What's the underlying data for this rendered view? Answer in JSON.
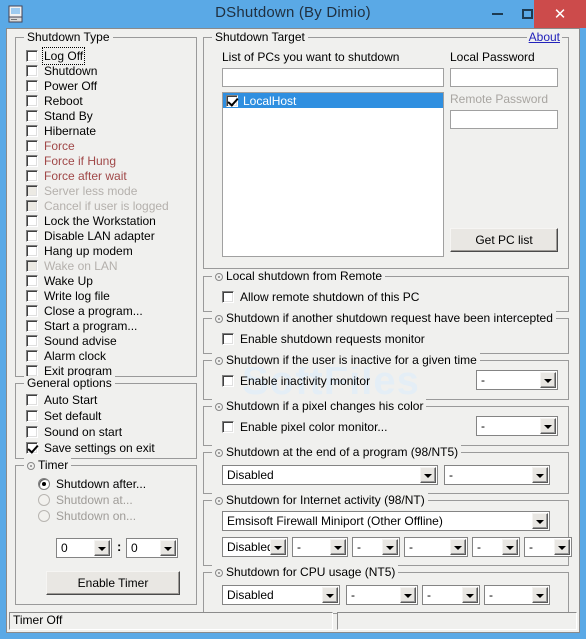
{
  "window": {
    "title": "DShutdown (By Dimio)",
    "app_icon": "computer-icon",
    "minimize_label": "–",
    "maximize_label": "□",
    "close_label": "✕",
    "accent_color": "#5aa9e6",
    "close_color": "#cc4b4b"
  },
  "shutdown_type": {
    "title": "Shutdown Type",
    "items": [
      {
        "label": "Log Off",
        "checked": false,
        "style": "normal",
        "focused": true
      },
      {
        "label": "Shutdown",
        "checked": false,
        "style": "normal",
        "focused": false
      },
      {
        "label": "Power Off",
        "checked": false,
        "style": "normal",
        "focused": false
      },
      {
        "label": "Reboot",
        "checked": false,
        "style": "normal",
        "focused": false
      },
      {
        "label": "Stand By",
        "checked": false,
        "style": "normal",
        "focused": false
      },
      {
        "label": "Hibernate",
        "checked": false,
        "style": "normal",
        "focused": false
      },
      {
        "label": "Force",
        "checked": false,
        "style": "red",
        "focused": false
      },
      {
        "label": "Force if Hung",
        "checked": false,
        "style": "red",
        "focused": false
      },
      {
        "label": "Force after wait",
        "checked": false,
        "style": "red",
        "focused": false
      },
      {
        "label": "Server less mode",
        "checked": false,
        "style": "grey",
        "focused": false
      },
      {
        "label": "Cancel if user is logged",
        "checked": false,
        "style": "grey",
        "focused": false
      },
      {
        "label": "Lock the Workstation",
        "checked": false,
        "style": "normal",
        "focused": false
      },
      {
        "label": "Disable LAN adapter",
        "checked": false,
        "style": "normal",
        "focused": false
      },
      {
        "label": "Hang up modem",
        "checked": false,
        "style": "normal",
        "focused": false
      },
      {
        "label": "Wake on LAN",
        "checked": false,
        "style": "grey",
        "focused": false
      },
      {
        "label": "Wake Up",
        "checked": false,
        "style": "normal",
        "focused": false
      },
      {
        "label": "Write log file",
        "checked": false,
        "style": "normal",
        "focused": false
      },
      {
        "label": "Close a program...",
        "checked": false,
        "style": "normal",
        "focused": false
      },
      {
        "label": "Start a program...",
        "checked": false,
        "style": "normal",
        "focused": false
      },
      {
        "label": "Sound advise",
        "checked": false,
        "style": "normal",
        "focused": false
      },
      {
        "label": "Alarm clock",
        "checked": false,
        "style": "normal",
        "focused": false
      },
      {
        "label": "Exit program",
        "checked": false,
        "style": "normal",
        "focused": false
      }
    ]
  },
  "general_options": {
    "title": "General options",
    "items": [
      {
        "label": "Auto Start",
        "checked": false
      },
      {
        "label": "Set default",
        "checked": false
      },
      {
        "label": "Sound on start",
        "checked": false
      },
      {
        "label": "Save settings on exit",
        "checked": true
      }
    ]
  },
  "timer": {
    "title": "Timer",
    "radios": [
      {
        "label": "Shutdown after...",
        "selected": true,
        "disabled": false
      },
      {
        "label": "Shutdown at...",
        "selected": false,
        "disabled": true
      },
      {
        "label": "Shutdown on...",
        "selected": false,
        "disabled": true
      }
    ],
    "hours_value": "0",
    "separator": ":",
    "minutes_value": "0",
    "enable_button": "Enable Timer"
  },
  "shutdown_target": {
    "title": "Shutdown Target",
    "about_link": "About",
    "list_label": "List of PCs you want to shutdown",
    "filter_value": "",
    "pc_list": [
      {
        "label": "LocalHost",
        "checked": true,
        "selected": true
      }
    ],
    "local_password_label": "Local Password",
    "local_password_value": "",
    "remote_password_label": "Remote Password",
    "remote_password_value": "",
    "get_pc_list_button": "Get PC list"
  },
  "local_remote": {
    "title": "Local shutdown from Remote",
    "checkbox_label": "Allow remote shutdown of this PC",
    "checked": false
  },
  "intercept": {
    "title": "Shutdown if another shutdown request have been intercepted",
    "checkbox_label": "Enable shutdown requests monitor",
    "checked": false
  },
  "inactivity": {
    "title": "Shutdown if the user is inactive for a given time",
    "checkbox_label": "Enable inactivity monitor",
    "checked": false,
    "combo_value": "-"
  },
  "pixel": {
    "title": "Shutdown if a pixel changes his color",
    "checkbox_label": "Enable pixel color monitor...",
    "checked": false,
    "combo_value": "-"
  },
  "end_of_program": {
    "title": "Shutdown at the end of a program (98/NT5)",
    "combo_main": "Disabled",
    "combo_second": "-"
  },
  "internet_activity": {
    "title": "Shutdown for Internet activity (98/NT)",
    "adapter_combo": "Emsisoft Firewall Miniport (Other Offline)",
    "combos": [
      "Disabled",
      "-",
      "-",
      "-",
      "-",
      "-"
    ]
  },
  "cpu_usage": {
    "title": "Shutdown for CPU usage (NT5)",
    "combos": [
      "Disabled",
      "-",
      "-",
      "-"
    ]
  },
  "statusbar": {
    "message": "Timer Off",
    "secondary": ""
  },
  "watermark": "SoftFiles"
}
